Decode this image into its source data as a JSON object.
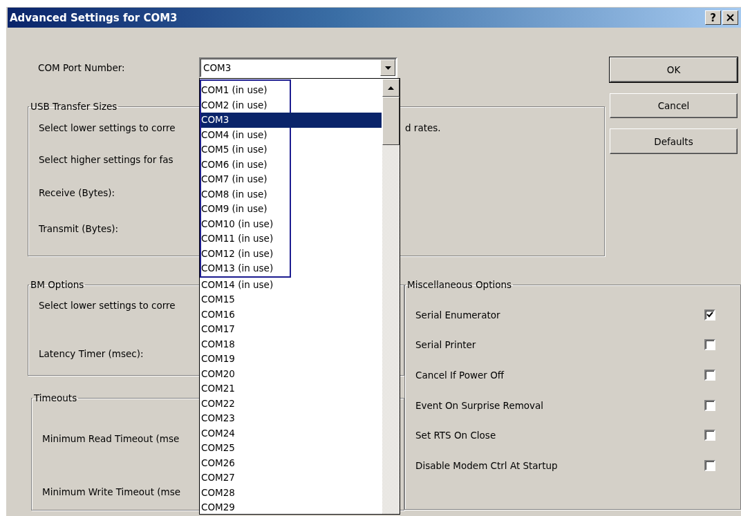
{
  "window": {
    "title": "Advanced Settings for COM3",
    "help_button": "?"
  },
  "com_port": {
    "label": "COM Port Number:",
    "value": "COM3",
    "expanded": true,
    "option_groups": [
      {
        "framed": true,
        "options": [
          {
            "label": "COM1 (in use)",
            "selected": false
          },
          {
            "label": "COM2 (in use)",
            "selected": false
          },
          {
            "label": "COM3",
            "selected": true
          },
          {
            "label": "COM4 (in use)",
            "selected": false
          },
          {
            "label": "COM5 (in use)",
            "selected": false
          },
          {
            "label": "COM6 (in use)",
            "selected": false
          },
          {
            "label": "COM7 (in use)",
            "selected": false
          },
          {
            "label": "COM8 (in use)",
            "selected": false
          },
          {
            "label": "COM9 (in use)",
            "selected": false
          },
          {
            "label": "COM10 (in use)",
            "selected": false
          },
          {
            "label": "COM11 (in use)",
            "selected": false
          },
          {
            "label": "COM12 (in use)",
            "selected": false
          },
          {
            "label": "COM13 (in use)",
            "selected": false
          }
        ]
      },
      {
        "framed": false,
        "options": [
          {
            "label": "COM14 (in use)",
            "selected": false
          },
          {
            "label": "COM15",
            "selected": false
          },
          {
            "label": "COM16",
            "selected": false
          },
          {
            "label": "COM17",
            "selected": false
          },
          {
            "label": "COM18",
            "selected": false
          },
          {
            "label": "COM19",
            "selected": false
          },
          {
            "label": "COM20",
            "selected": false
          },
          {
            "label": "COM21",
            "selected": false
          },
          {
            "label": "COM22",
            "selected": false
          },
          {
            "label": "COM23",
            "selected": false
          },
          {
            "label": "COM24",
            "selected": false
          },
          {
            "label": "COM25",
            "selected": false
          },
          {
            "label": "COM26",
            "selected": false
          },
          {
            "label": "COM27",
            "selected": false
          },
          {
            "label": "COM28",
            "selected": false
          },
          {
            "label": "COM29",
            "selected": false
          }
        ]
      }
    ]
  },
  "buttons": [
    {
      "label": "OK",
      "default": true
    },
    {
      "label": "Cancel",
      "default": false
    },
    {
      "label": "Defaults",
      "default": false
    }
  ],
  "usb_transfer_sizes": {
    "title": "USB Transfer Sizes",
    "rows": [
      {
        "text": "Select lower settings to corre",
        "text_after_list": "d rates."
      },
      {
        "text": "Select higher settings for fas"
      },
      {
        "text": "Receive (Bytes):"
      },
      {
        "text": "Transmit (Bytes):"
      }
    ]
  },
  "bm_options": {
    "title": "BM Options",
    "rows": [
      {
        "text": "Select lower settings to corre"
      },
      {
        "text": "Latency Timer (msec):"
      }
    ]
  },
  "timeouts": {
    "title": "Timeouts",
    "rows": [
      {
        "text": "Minimum Read Timeout (mse"
      },
      {
        "text": "Minimum Write Timeout (mse"
      }
    ]
  },
  "miscellaneous_options": {
    "title": "Miscellaneous Options",
    "options": [
      {
        "label": "Serial Enumerator",
        "checked": true
      },
      {
        "label": "Serial Printer",
        "checked": false
      },
      {
        "label": "Cancel If Power Off",
        "checked": false
      },
      {
        "label": "Event On Surprise Removal",
        "checked": false
      },
      {
        "label": "Set RTS On Close",
        "checked": false
      },
      {
        "label": "Disable Modem Ctrl At Startup",
        "checked": false
      }
    ]
  }
}
